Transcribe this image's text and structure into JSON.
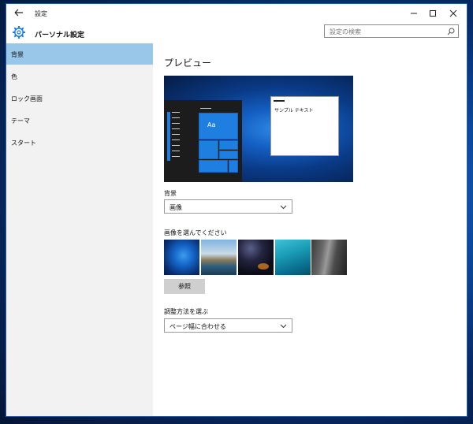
{
  "window": {
    "title": "設定"
  },
  "header": {
    "title": "パーソナル設定",
    "search_placeholder": "設定の検索"
  },
  "sidebar": {
    "items": [
      {
        "label": "背景",
        "active": true
      },
      {
        "label": "色",
        "active": false
      },
      {
        "label": "ロック画面",
        "active": false
      },
      {
        "label": "テーマ",
        "active": false
      },
      {
        "label": "スタート",
        "active": false
      }
    ]
  },
  "main": {
    "preview_heading": "プレビュー",
    "preview": {
      "tile_label": "Aa",
      "sample_text": "サンプル テキスト"
    },
    "background_label": "背景",
    "background_value": "画像",
    "choose_image_label": "画像を選んでください",
    "images": [
      "windows-hero",
      "beach",
      "night-sky",
      "underwater",
      "rock-wall"
    ],
    "browse_button": "参照",
    "fit_label": "調整方法を選ぶ",
    "fit_value": "ページ幅に合わせる"
  },
  "colors": {
    "accent": "#1e7fe0",
    "nav_active": "#99c7e9",
    "sidebar_bg": "#f2f2f2"
  }
}
